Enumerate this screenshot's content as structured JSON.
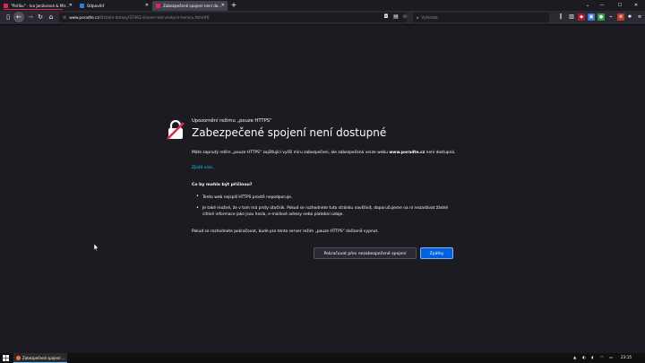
{
  "tabs": [
    {
      "label": "\"Pořiku\" - Iva Janžurová & Mir...",
      "favicon_color": "#e22850",
      "active": false,
      "playing": true
    },
    {
      "label": "Odpověď",
      "favicon_color": "#2f7fe0",
      "active": false
    },
    {
      "label": "Zabezpečené spojení není do...",
      "favicon_color": "#e22850",
      "active": true
    }
  ],
  "toolbar": {
    "url_host": "www.poradte.cz",
    "url_path": "/Ostatni-dotazy/37461-slavne-role-veskych-herecu.html#6",
    "search_placeholder": "Vyhledat"
  },
  "error": {
    "subtitle": "Upozornění režimu „pouze HTTPS“",
    "title": "Zabezpečené spojení není dostupné",
    "para1_a": "Máte zapnutý režim „pouze HTTPS“ zajišťující vyšší míru zabezpečení, ale zabezpečená verze webu ",
    "para1_host": "www.poradte.cz",
    "para1_b": " není dostupná.",
    "learn_more": "Zjistit více...",
    "causes_heading": "Co by mohlo být příčinou?",
    "cause1": "Tento web nejspíš HTTPS prostě nepodporuje.",
    "cause2": "Je také možné, že v tom má prsty útočník. Pokud se rozhodnete tuto stránku navštívit, doporučujeme na ní nezadávat žádné citlivé informace jako jsou hesla, e-mailové adresy nebo platební údaje.",
    "para2": "Pokud se rozhodnete pokračovat, bude pro tento server režim „pouze HTTPS“ dočasně vypnut.",
    "continue_button": "Pokračovat přes nezabezpečené spojení",
    "back_button": "Zpátky"
  },
  "taskbar": {
    "item_label": "Zabezpečené spojení ...",
    "clock": "23:15"
  },
  "colors": {
    "accent": "#0060df",
    "link": "#00ddff",
    "brand_red": "#e22850"
  }
}
